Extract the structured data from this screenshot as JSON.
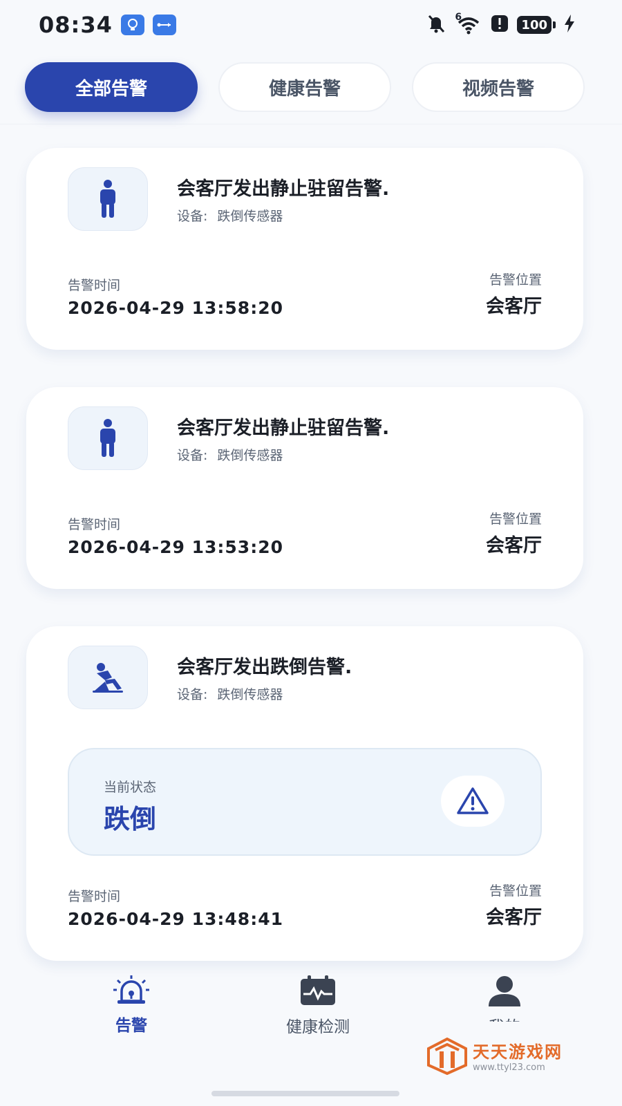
{
  "status_bar": {
    "time": "08:34",
    "battery": "100",
    "signal_label": "6"
  },
  "tabs": [
    {
      "label": "全部告警",
      "active": true
    },
    {
      "label": "健康告警",
      "active": false
    },
    {
      "label": "视频告警",
      "active": false
    }
  ],
  "alerts": [
    {
      "title": "会客厅发出静止驻留告警.",
      "device_label": "设备:",
      "device": "跌倒传感器",
      "time_label": "告警时间",
      "time": "2026-04-29 13:58:20",
      "location_label": "告警位置",
      "location": "会客厅"
    },
    {
      "title": "会客厅发出静止驻留告警.",
      "device_label": "设备:",
      "device": "跌倒传感器",
      "time_label": "告警时间",
      "time": "2026-04-29 13:53:20",
      "location_label": "告警位置",
      "location": "会客厅"
    },
    {
      "title": "会客厅发出跌倒告警.",
      "device_label": "设备:",
      "device": "跌倒传感器",
      "state_label": "当前状态",
      "state_value": "跌倒",
      "time_label": "告警时间",
      "time": "2026-04-29 13:48:41",
      "location_label": "告警位置",
      "location": "会客厅"
    }
  ],
  "bottom_nav": [
    {
      "label": "告警",
      "icon": "alarm-light-icon",
      "active": true
    },
    {
      "label": "健康检测",
      "icon": "health-calendar-icon",
      "active": false
    },
    {
      "label": "我的",
      "icon": "person-icon",
      "active": false
    }
  ],
  "watermark": {
    "main": "天天游戏网",
    "sub": "www.ttyl23.com"
  },
  "colors": {
    "accent": "#2a45ad",
    "background": "#f7f9fc",
    "card": "#ffffff",
    "watermark": "#e36b2a"
  }
}
